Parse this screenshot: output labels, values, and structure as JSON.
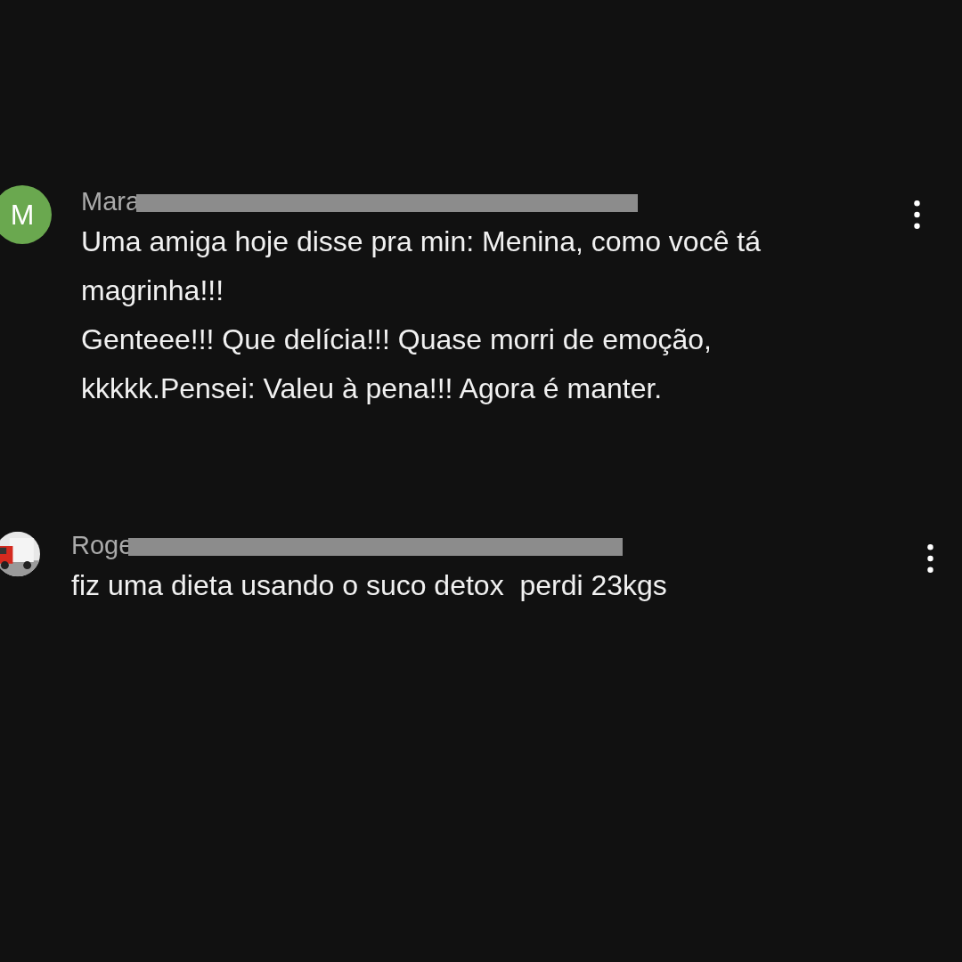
{
  "comments": [
    {
      "avatar": {
        "kind": "letter",
        "letter": "M",
        "color": "#6aa84f"
      },
      "author": "Mara",
      "paragraphs": [
        "Uma amiga hoje disse pra min: Menina, como você tá magrinha!!!",
        "Genteee!!! Que delícia!!! Quase morri de emoção, kkkkk.Pensei: Valeu à pena!!! Agora é manter."
      ]
    },
    {
      "avatar": {
        "kind": "picture"
      },
      "author": "Roge",
      "paragraphs": [
        "fiz uma dieta usando o suco detox  perdi 23kgs"
      ]
    }
  ]
}
